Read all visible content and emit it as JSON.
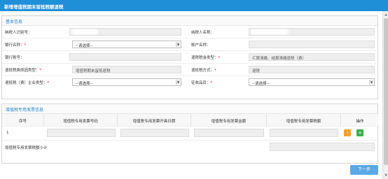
{
  "window": {
    "title": "新增增值税期末留抵税额退税"
  },
  "basic": {
    "heading": "基本信息",
    "taxpayer_id_label": "纳税人识别号：",
    "taxpayer_name_label": "纳税人名称：",
    "bank_name_label": "银行名称：",
    "bank_select": "--请选择--",
    "account_name_label": "账户名称：",
    "bank_account_label": "银行账号：",
    "refund_type_label": "退税税金类型：",
    "refund_type_value": "汇算清缴、结算清缴退税（费）",
    "refund_basis_label": "退抵税费原因类型：",
    "refund_basis_value": "增值税期末留抵退税",
    "refund_method_label": "退抵税方式：",
    "refund_method_value": "退税",
    "enterprise_type_label": "退抵税（费）企业类型：",
    "enterprise_select": "--请选择--",
    "tax_authority_label": "征收品目：",
    "tax_authority_select": "--请选择--",
    "required_mark": "*"
  },
  "invoice": {
    "heading": "增值税专用发票信息",
    "columns": [
      "序号",
      "增值税专用发票号码",
      "增值税专用发票开具日期",
      "增值税专用发票金额",
      "增值税专用发票税额",
      "操作"
    ],
    "row_index": "1",
    "minus": "-",
    "plus": "+",
    "subtotal_label": "增值税专用发票税额小计"
  },
  "footer": {
    "next": "下一步"
  },
  "colors": {
    "titlebar": "#1f8fd8",
    "accent": "#2b86c5",
    "minus": "#f0a030",
    "plus": "#3cb04a"
  }
}
